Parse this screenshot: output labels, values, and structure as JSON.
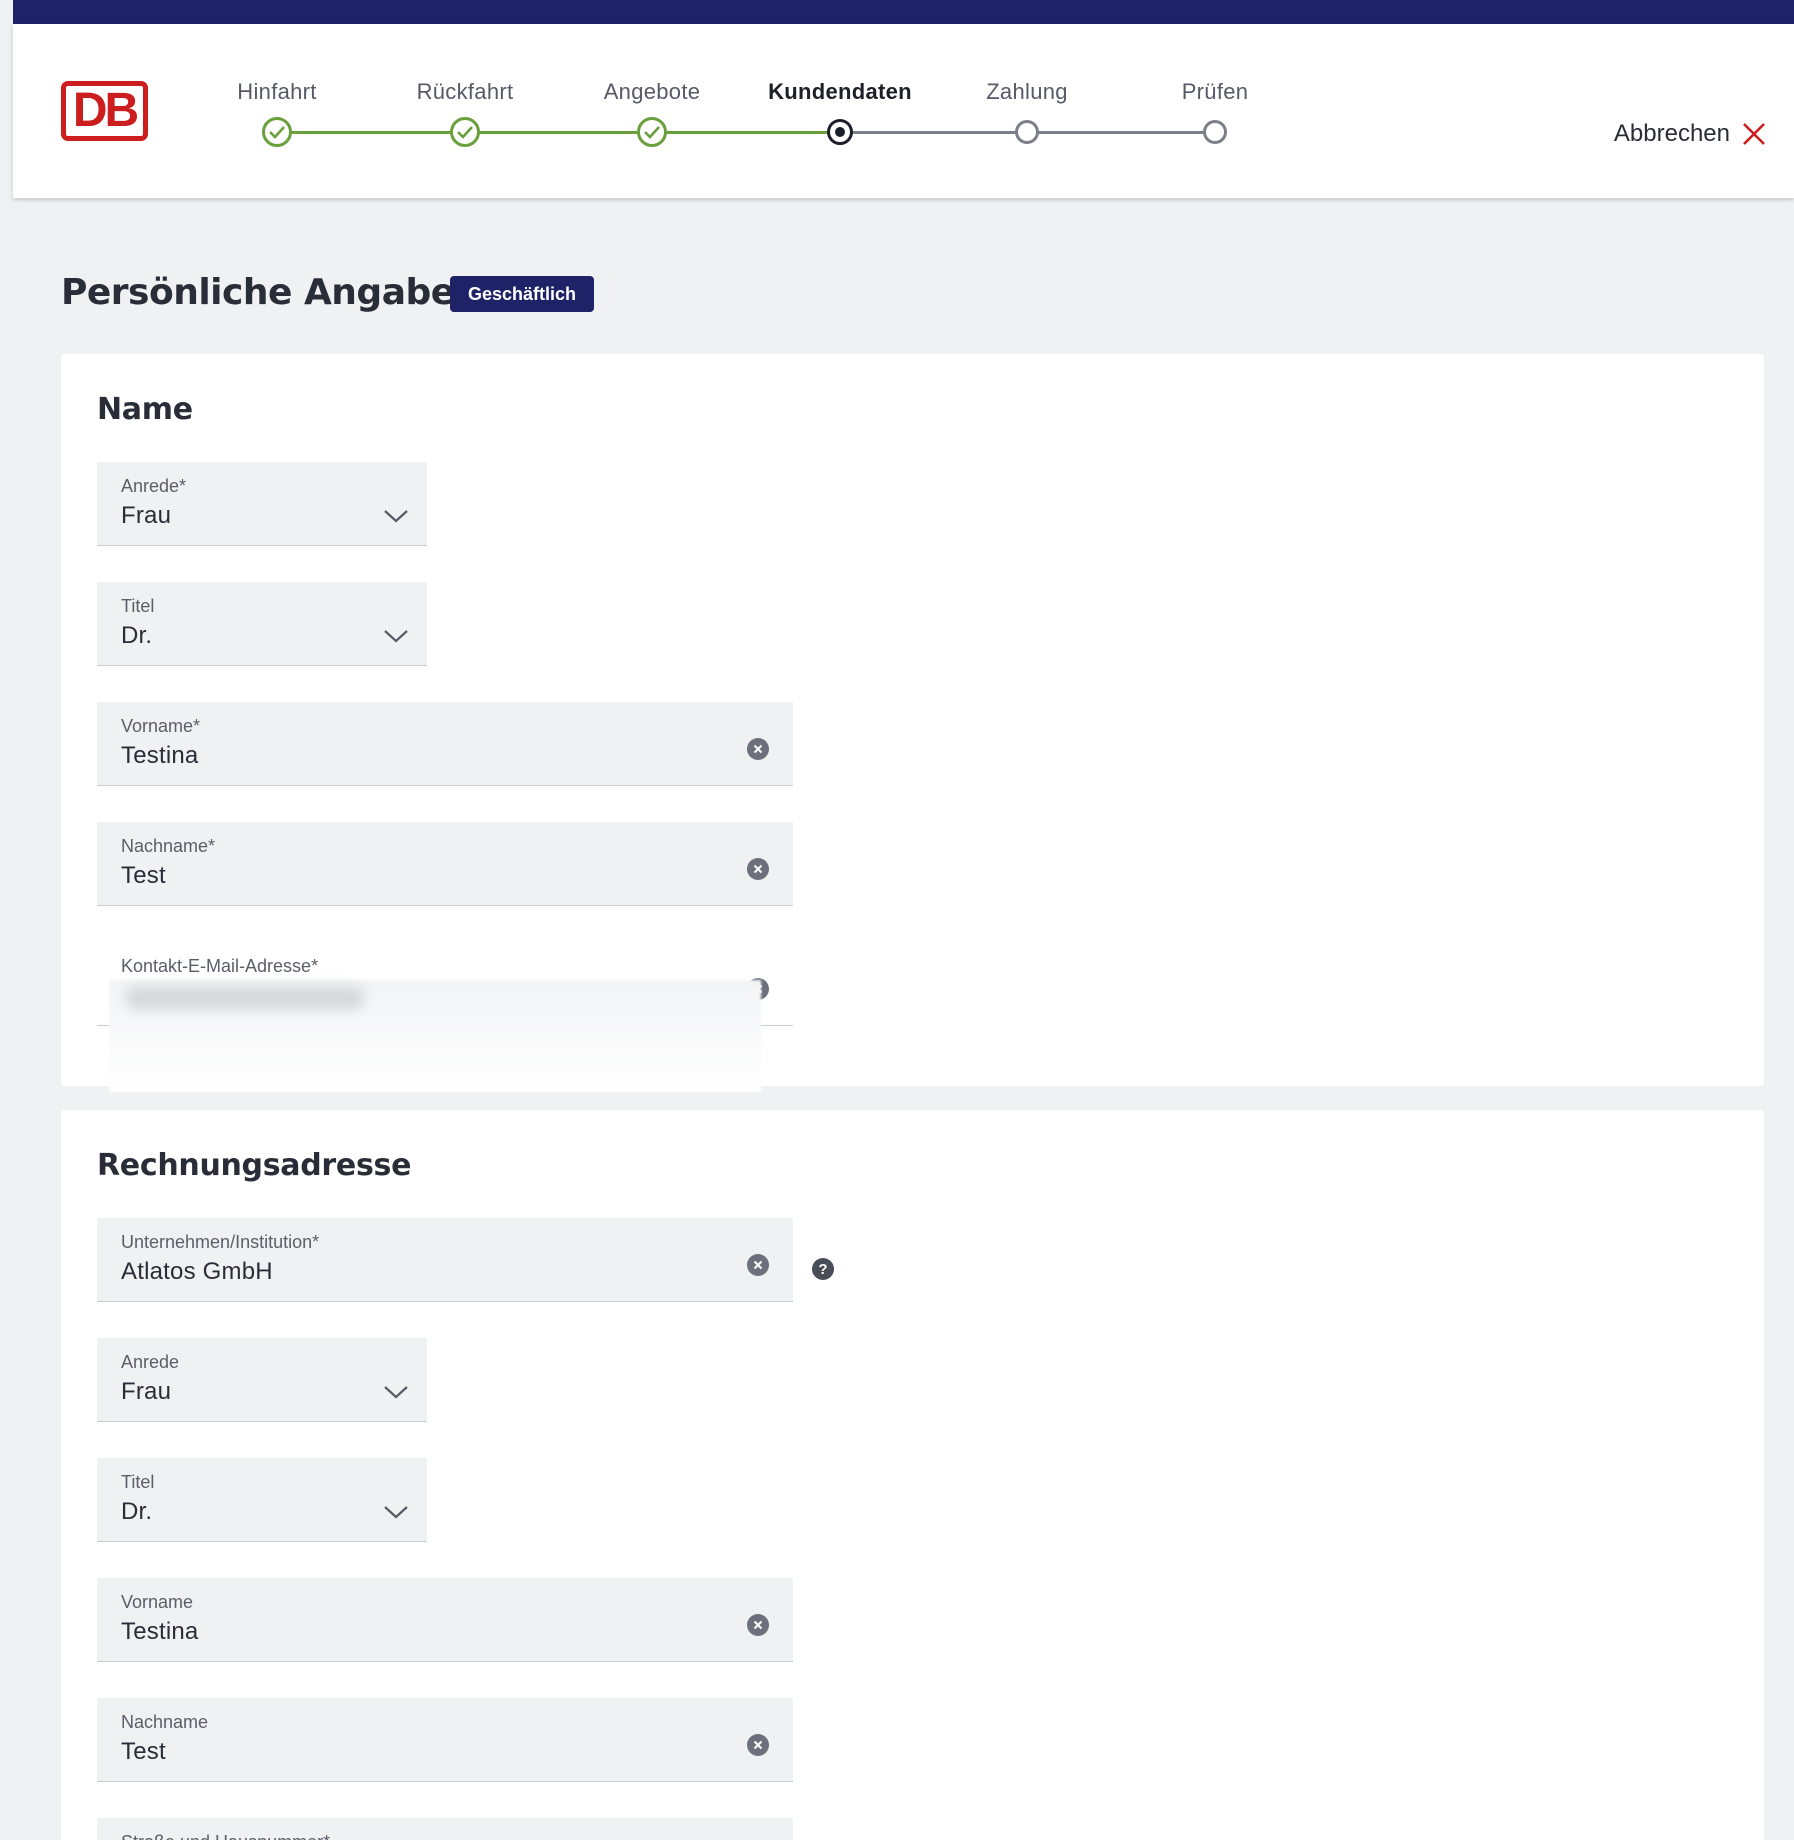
{
  "header": {
    "logo_text": "DB",
    "steps": [
      {
        "label": "Hinfahrt",
        "state": "done"
      },
      {
        "label": "Rückfahrt",
        "state": "done"
      },
      {
        "label": "Angebote",
        "state": "done"
      },
      {
        "label": "Kundendaten",
        "state": "current"
      },
      {
        "label": "Zahlung",
        "state": "todo"
      },
      {
        "label": "Prüfen",
        "state": "todo"
      }
    ],
    "cancel_label": "Abbrechen"
  },
  "page": {
    "title": "Persönliche Angaben",
    "badge": "Geschäftlich"
  },
  "name_section": {
    "title": "Name",
    "anrede": {
      "label": "Anrede*",
      "value": "Frau"
    },
    "titel": {
      "label": "Titel",
      "value": "Dr."
    },
    "vorname": {
      "label": "Vorname*",
      "value": "Testina"
    },
    "nachname": {
      "label": "Nachname*",
      "value": "Test"
    },
    "email": {
      "label": "Kontakt-E-Mail-Adresse*",
      "value": ""
    }
  },
  "billing_section": {
    "title": "Rechnungsadresse",
    "company": {
      "label": "Unternehmen/Institution*",
      "value": "Atlatos GmbH"
    },
    "anrede": {
      "label": "Anrede",
      "value": "Frau"
    },
    "titel": {
      "label": "Titel",
      "value": "Dr."
    },
    "vorname": {
      "label": "Vorname",
      "value": "Testina"
    },
    "nachname": {
      "label": "Nachname",
      "value": "Test"
    },
    "street": {
      "label": "Straße und Hausnummer*",
      "value": ""
    }
  },
  "colors": {
    "brand_red": "#cc1e1e",
    "navy": "#1e2266",
    "step_done": "#69a03c",
    "step_todo": "#7b7f89"
  }
}
